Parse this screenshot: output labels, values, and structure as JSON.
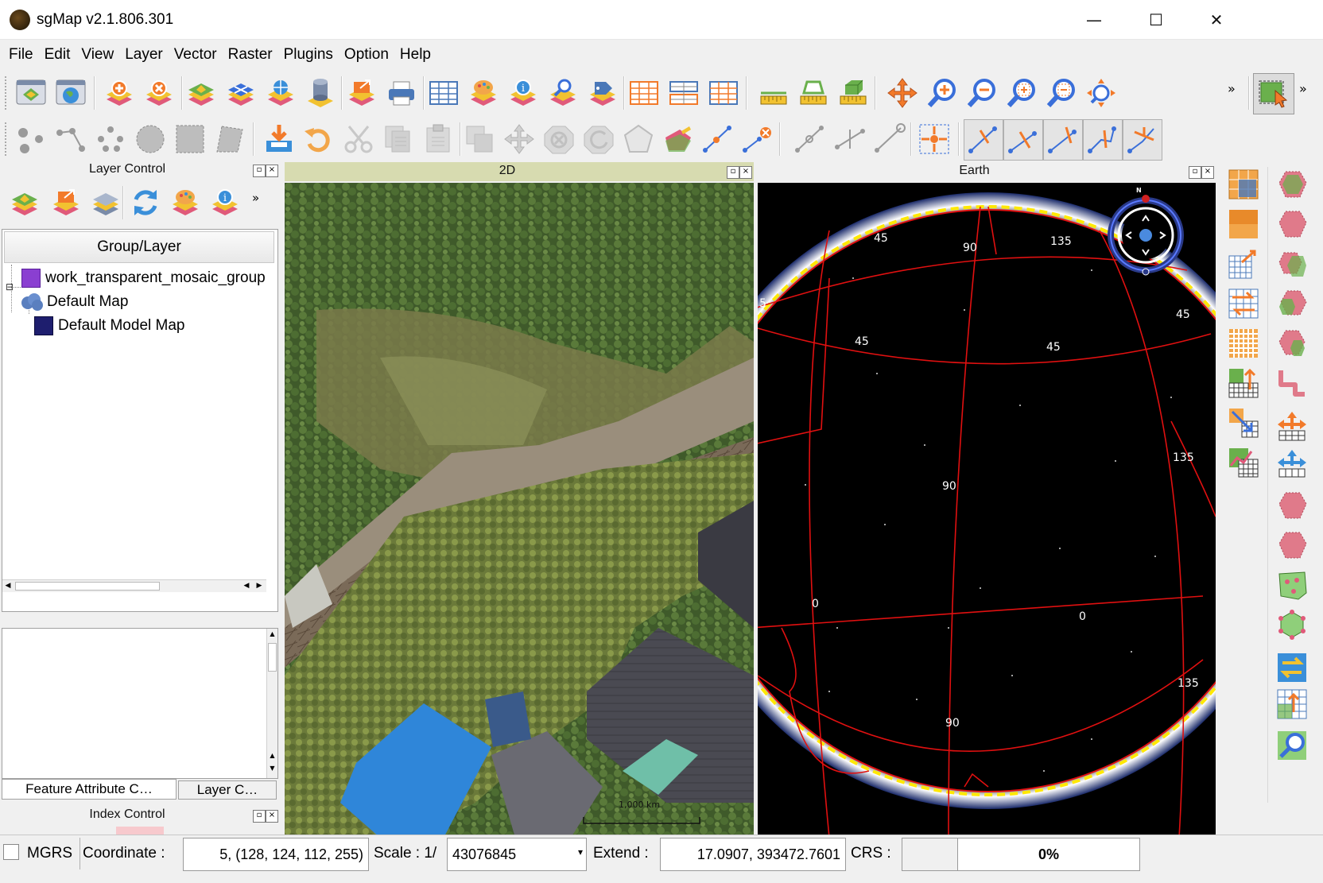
{
  "window": {
    "title": "sgMap v2.1.806.301",
    "minimize_glyph": "—",
    "maximize_glyph": "☐",
    "close_glyph": "✕"
  },
  "menu": [
    "File",
    "Edit",
    "View",
    "Layer",
    "Vector",
    "Raster",
    "Plugins",
    "Option",
    "Help"
  ],
  "toolbar": {
    "overflow_glyph": "»"
  },
  "layer_control": {
    "title": "Layer Control",
    "overflow_glyph": "»",
    "column_header": "Group/Layer",
    "layers": [
      {
        "name": "work_transparent_mosaic_group",
        "color": "#8a3fd1"
      },
      {
        "name": "Default Map",
        "color": "#5a7fbf"
      },
      {
        "name": "Default Model Map",
        "color": "#1e1e6e"
      }
    ],
    "tree_expander": "⊟"
  },
  "bottom_tabs": [
    "Feature Attribute C…",
    "Layer C…"
  ],
  "index_control": {
    "title": "Index Control"
  },
  "view_2d": {
    "title": "2D",
    "scalebar_label": "1,000 km"
  },
  "view_earth": {
    "title": "Earth",
    "compass_north": "N",
    "grid_labels": [
      "45",
      "90",
      "135",
      "45",
      "45",
      "45",
      "135",
      "90",
      "0",
      "0",
      "90",
      "135",
      "5"
    ]
  },
  "status": {
    "mgrs_label": "MGRS",
    "coordinate_label": "Coordinate :",
    "coordinate_value": "5, (128, 124, 112, 255)",
    "scale_label": "Scale : 1/",
    "scale_value": "43076845",
    "scale_dropdown_glyph": "▾",
    "extend_label": "Extend :",
    "extend_value": "17.0907, 393472.7601",
    "crs_label": "CRS :",
    "crs_value": "",
    "progress": "0%"
  },
  "colors": {
    "accent_layer": "#f2c230",
    "grid_red": "#e01010",
    "earth_bg": "#000000",
    "view_title_bg": "#d7dbb0"
  }
}
